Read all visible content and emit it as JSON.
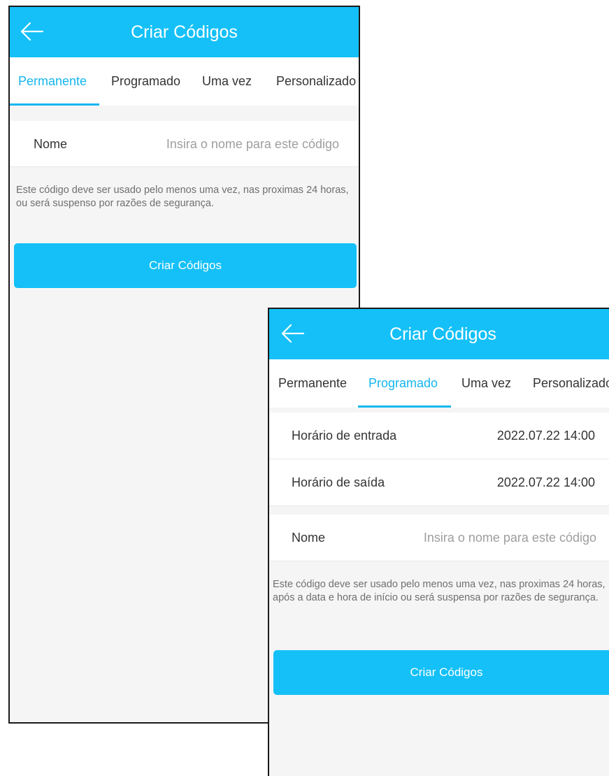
{
  "screens": [
    {
      "header": {
        "title": "Criar Códigos"
      },
      "tabs": [
        {
          "label": "Permanente"
        },
        {
          "label": "Programado"
        },
        {
          "label": "Uma vez"
        },
        {
          "label": "Personalizado"
        }
      ],
      "active_tab": "Permanente",
      "form": {
        "name_label": "Nome",
        "name_placeholder": "Insira o nome para este código",
        "name_value": ""
      },
      "notice": "Este código deve ser usado pelo menos uma vez, nas proximas 24 horas, ou será suspenso por razões de segurança.",
      "submit_label": "Criar Códigos"
    },
    {
      "header": {
        "title": "Criar Códigos"
      },
      "tabs": [
        {
          "label": "Permanente"
        },
        {
          "label": "Programado"
        },
        {
          "label": "Uma vez"
        },
        {
          "label": "Personalizado"
        }
      ],
      "active_tab": "Programado",
      "form": {
        "start_label": "Horário de entrada",
        "start_value": "2022.07.22 14:00",
        "end_label": "Horário de saída",
        "end_value": "2022.07.22 14:00",
        "name_label": "Nome",
        "name_placeholder": "Insira o nome para este código",
        "name_value": ""
      },
      "notice": "Este código deve ser usado pelo menos uma vez, nas proximas 24 horas, após a data e hora de início ou será suspensa por razões de segurança.",
      "submit_label": "Criar Códigos"
    }
  ],
  "colors": {
    "accent": "#14c0f7",
    "tab_active": "#14b6ee",
    "background": "#f5f5f5",
    "text": "#333333",
    "placeholder": "#9e9e9e",
    "notice_text": "#6f6f6f"
  },
  "icons": {
    "back": "arrow-left-icon"
  }
}
